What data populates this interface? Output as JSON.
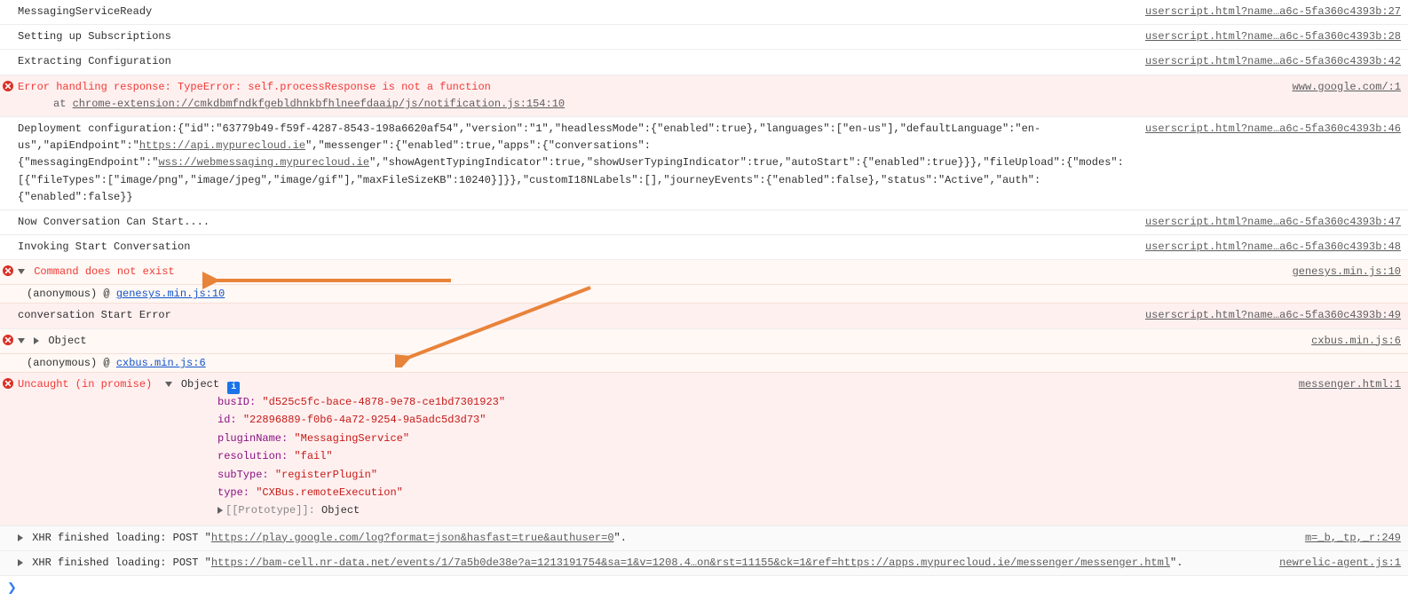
{
  "rows": {
    "r1": {
      "msg": "MessagingServiceReady",
      "src": "userscript.html?name…a6c-5fa360c4393b:27"
    },
    "r2": {
      "msg": "Setting up Subscriptions",
      "src": "userscript.html?name…a6c-5fa360c4393b:28"
    },
    "r3": {
      "msg": "Extracting Configuration",
      "src": "userscript.html?name…a6c-5fa360c4393b:42"
    },
    "r4": {
      "msg": "Error handling response: TypeError: self.processResponse is not a function",
      "at": "at ",
      "stack": "chrome-extension://cmkdbmfndkfgebldhnkbfhlneefdaaip/js/notification.js:154:10",
      "src": "www.google.com/:1"
    },
    "r5": {
      "pre1": "Deployment configuration:{\"id\":\"63779b49-f59f-4287-8543-198a6620af54\",\"version\":\"1\",\"headlessMode\":{\"enabled\":true},\"languages\":[\"en-us\"],\"defaultLanguage\":\"en-us\",\"apiEndpoint\":\"",
      "link1": "https://api.mypurecloud.ie",
      "mid1": "\",\"messenger\":{\"enabled\":true,\"apps\":{\"conversations\":{\"messagingEndpoint\":\"",
      "link2": "wss://webmessaging.mypurecloud.ie",
      "post1": "\",\"showAgentTypingIndicator\":true,\"showUserTypingIndicator\":true,\"autoStart\":{\"enabled\":true}}},\"fileUpload\":{\"modes\":[{\"fileTypes\":[\"image/png\",\"image/jpeg\",\"image/gif\"],\"maxFileSizeKB\":10240}]}},\"customI18NLabels\":[],\"journeyEvents\":{\"enabled\":false},\"status\":\"Active\",\"auth\":{\"enabled\":false}}",
      "src": "userscript.html?name…a6c-5fa360c4393b:46"
    },
    "r6": {
      "msg": "Now Conversation Can Start....",
      "src": "userscript.html?name…a6c-5fa360c4393b:47"
    },
    "r7": {
      "msg": "Invoking Start Conversation",
      "src": "userscript.html?name…a6c-5fa360c4393b:48"
    },
    "r8": {
      "msg": "Command does not exist",
      "src": "genesys.min.js:10"
    },
    "r8s": {
      "anon": "(anonymous)",
      "at": "@",
      "link": "genesys.min.js:10"
    },
    "r9": {
      "msg": "conversation Start Error",
      "src": "userscript.html?name…a6c-5fa360c4393b:49"
    },
    "r10": {
      "obj": "Object",
      "src": "cxbus.min.js:6"
    },
    "r10s": {
      "anon": "(anonymous)",
      "at": "@",
      "link": "cxbus.min.js:6"
    },
    "r11": {
      "uncaught": "Uncaught (in promise)",
      "obj": "Object",
      "src": "messenger.html:1",
      "props": {
        "busID_k": "busID:",
        "busID_v": "\"d525c5fc-bace-4878-9e78-ce1bd7301923\"",
        "id_k": "id:",
        "id_v": "\"22896889-f0b6-4a72-9254-9a5adc5d3d73\"",
        "plugin_k": "pluginName:",
        "plugin_v": "\"MessagingService\"",
        "res_k": "resolution:",
        "res_v": "\"fail\"",
        "sub_k": "subType:",
        "sub_v": "\"registerPlugin\"",
        "type_k": "type:",
        "type_v": "\"CXBus.remoteExecution\"",
        "proto_k": "[[Prototype]]:",
        "proto_v": "Object"
      }
    },
    "r12": {
      "pre": "XHR finished loading: POST \"",
      "url": "https://play.google.com/log?format=json&hasfast=true&authuser=0",
      "post": "\".",
      "src": "m=_b,_tp,_r:249"
    },
    "r13": {
      "pre": "XHR finished loading: POST \"",
      "url": "https://bam-cell.nr-data.net/events/1/7a5b0de38e?a=1213191754&sa=1&v=1208.4…on&rst=11155&ck=1&ref=https://apps.mypurecloud.ie/messenger/messenger.html",
      "post": "\".",
      "src": "newrelic-agent.js:1"
    }
  },
  "prompt": "❯",
  "info_glyph": "i"
}
